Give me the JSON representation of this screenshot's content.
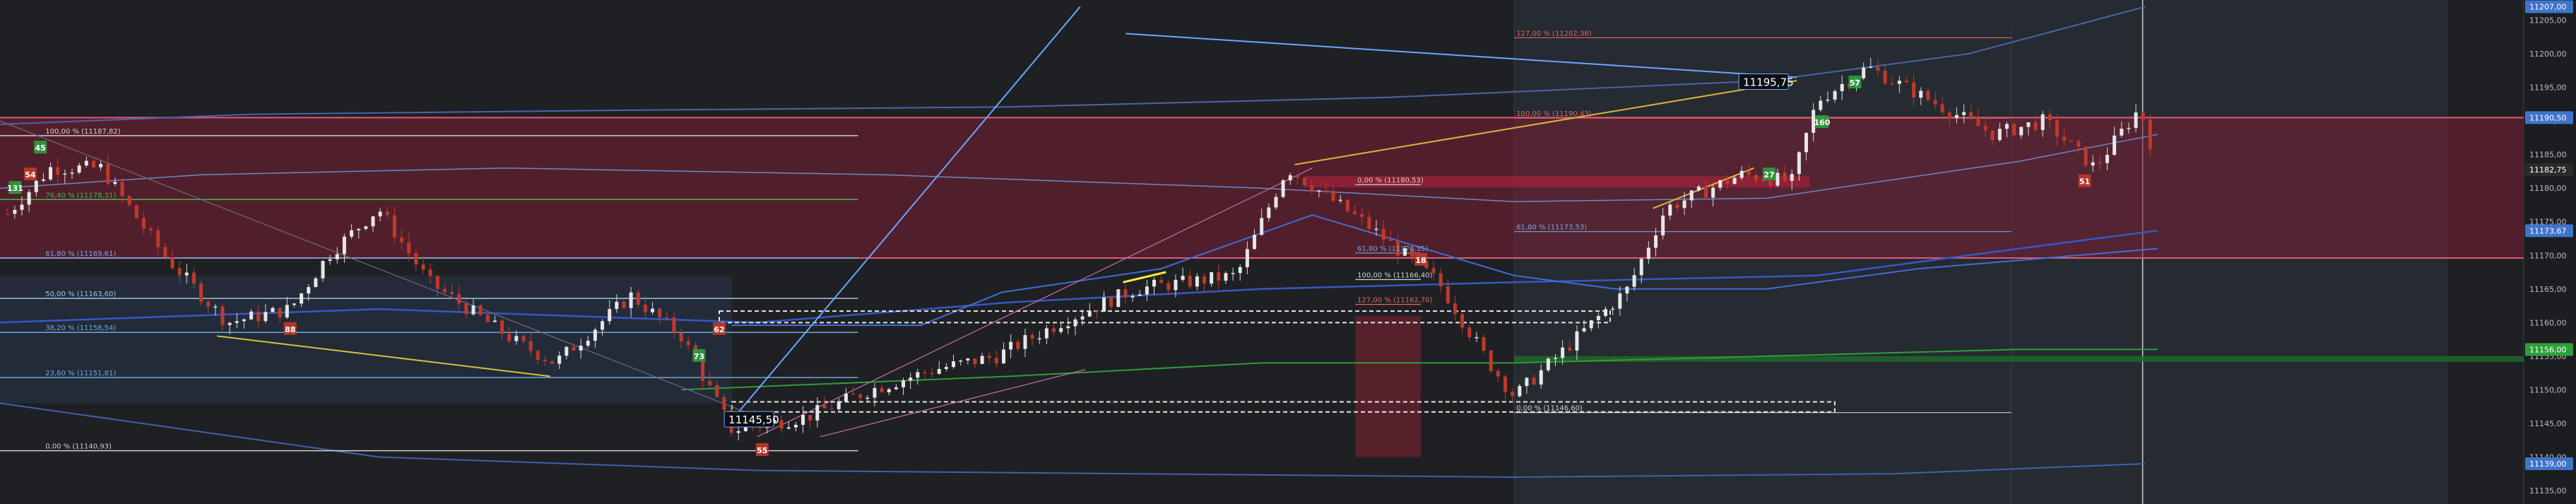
{
  "chart_data": {
    "type": "candlestick",
    "ylim": [
      11133,
      11208
    ],
    "price_axis_ticks": [
      "11205,00",
      "11200,00",
      "11195,00",
      "11190,00",
      "11185,00",
      "11180,00",
      "11175,00",
      "11170,00",
      "11165,00",
      "11160,00",
      "11155,00",
      "11150,00",
      "11145,00",
      "11140,00",
      "11135,00"
    ],
    "price_tags": [
      {
        "label": "11207,00",
        "value": 11207.0,
        "color": "#3f74c9"
      },
      {
        "label": "11190,50",
        "value": 11190.5,
        "color": "#3f74c9"
      },
      {
        "label": "11182,75",
        "value": 11182.75,
        "color": "#2b2b2b"
      },
      {
        "label": "11173,67",
        "value": 11173.67,
        "color": "#3f74c9"
      },
      {
        "label": "11156,00",
        "value": 11156.0,
        "color": "#2e9e3b"
      },
      {
        "label": "11139,00",
        "value": 11139.0,
        "color": "#3f74c9"
      }
    ],
    "fib_left": [
      {
        "label": "100,00 % (11187,82)",
        "value": 11187.82,
        "color": "#cfcfcf"
      },
      {
        "label": "76,40 % (11178,31)",
        "value": 11178.31,
        "color": "#4caf50"
      },
      {
        "label": "61,80 % (11169,61)",
        "value": 11169.61,
        "color": "#6fa8dc"
      },
      {
        "label": "50,00 % (11163,60)",
        "value": 11163.6,
        "color": "#9fc5e8"
      },
      {
        "label": "38,20 % (11158,54)",
        "value": 11158.54,
        "color": "#6fa8dc"
      },
      {
        "label": "23,60 % (11151,81)",
        "value": 11151.81,
        "color": "#6fa8dc"
      },
      {
        "label": "0,00 % (11140,93)",
        "value": 11140.93,
        "color": "#cfcfcf"
      }
    ],
    "fib_right": [
      {
        "label": "127,00 % (11202,38)",
        "value": 11202.38,
        "color": "#e06666"
      },
      {
        "label": "100,00 % (11190,43)",
        "value": 11190.43,
        "color": "#e06666"
      },
      {
        "label": "0,00 % (11180,53)",
        "value": 11180.53,
        "color": "#cfcfcf"
      },
      {
        "label": "61,80 % (11173,53)",
        "value": 11173.53,
        "color": "#6fa8dc"
      },
      {
        "label": "61,80 % (11170,35)",
        "value": 11170.35,
        "color": "#6fa8dc"
      },
      {
        "label": "100,00 % (11166,40)",
        "value": 11166.4,
        "color": "#cfcfcf"
      },
      {
        "label": "127,00 % (11162,70)",
        "value": 11162.7,
        "color": "#e06666"
      },
      {
        "label": "0,00 % (11146,60)",
        "value": 11146.6,
        "color": "#cfcfcf"
      }
    ],
    "callouts": [
      {
        "label": "11195,75",
        "value": 11195.75
      },
      {
        "label": "11145,50",
        "value": 11145.5
      }
    ],
    "bar_counts": [
      {
        "label": "131",
        "color": "#2e9e3b"
      },
      {
        "label": "54",
        "color": "#c0392b"
      },
      {
        "label": "45",
        "color": "#2e9e3b"
      },
      {
        "label": "88",
        "color": "#c0392b"
      },
      {
        "label": "73",
        "color": "#2e9e3b"
      },
      {
        "label": "62",
        "color": "#c0392b"
      },
      {
        "label": "55",
        "color": "#c0392b"
      },
      {
        "label": "18",
        "color": "#c0392b"
      },
      {
        "label": "27",
        "color": "#2e9e3b"
      },
      {
        "label": "160",
        "color": "#2e9e3b"
      },
      {
        "label": "57",
        "color": "#2e9e3b"
      },
      {
        "label": "51",
        "color": "#c0392b"
      }
    ],
    "colors": {
      "bull": "#e6e6e6",
      "bear": "#c0392b",
      "zone": "#7a1f33",
      "grid": "#2c2d31"
    }
  }
}
